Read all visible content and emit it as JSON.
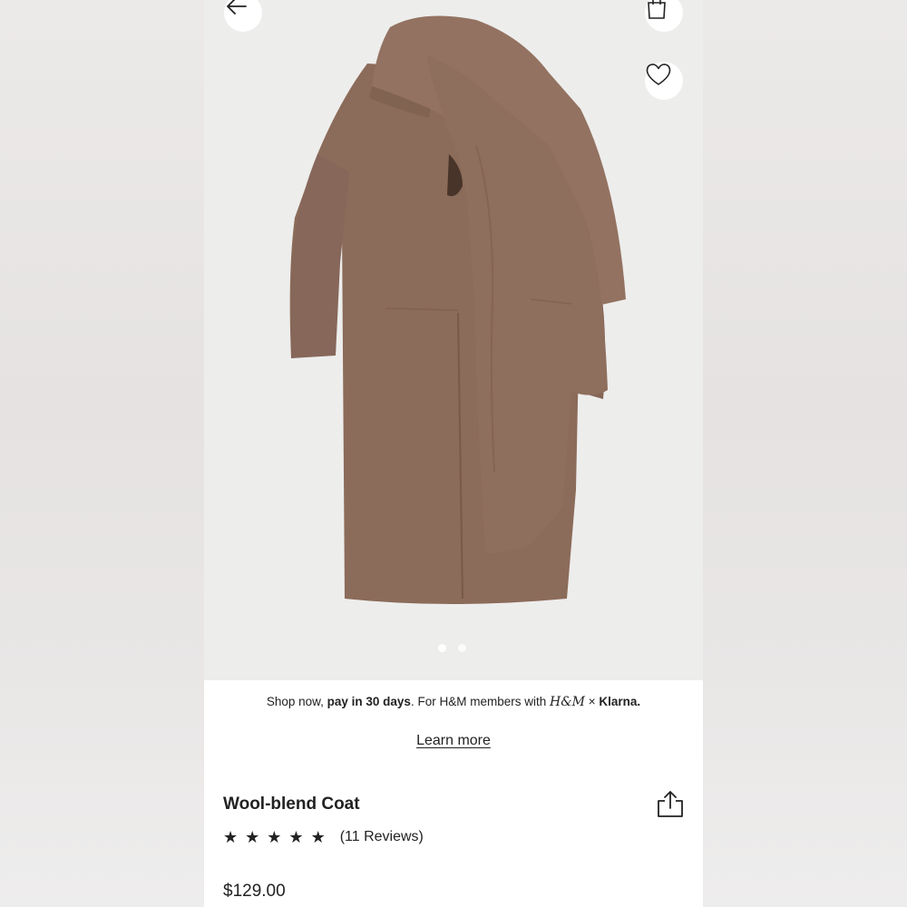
{
  "nav": {
    "back_icon": "arrow-left-icon",
    "bag_icon": "shopping-bag-icon",
    "wishlist_icon": "heart-icon"
  },
  "gallery": {
    "image_count": 2,
    "active_index": 0
  },
  "promo": {
    "prefix": "Shop now, ",
    "bold": "pay in 30 days",
    "middle": ". For H&M members with ",
    "hm_logo": "H&M",
    "times": " × ",
    "klarna": "Klarna."
  },
  "learn_more": "Learn more",
  "product": {
    "title": "Wool-blend Coat",
    "rating": 5,
    "reviews": "(11 Reviews)",
    "price": "$129.00",
    "share_icon": "share-icon"
  },
  "colors": {
    "coat": "#8a6a58",
    "text": "#222222",
    "hero_bg": "#ededec"
  }
}
